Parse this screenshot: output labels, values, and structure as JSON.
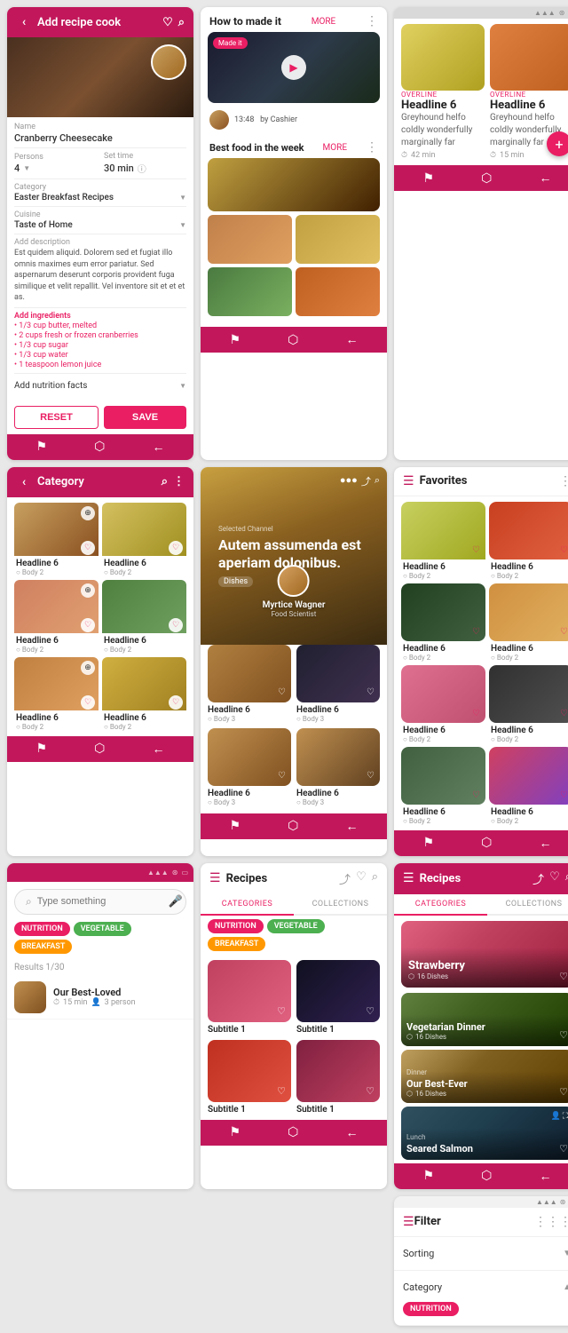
{
  "col1": {
    "card1": {
      "title": "Add recipe cook",
      "recipeName": "Cranberry Cheesecake",
      "persons_label": "Persons",
      "persons_value": "4",
      "setTime_label": "Set time",
      "setTime_value": "30 min",
      "category_label": "Category",
      "category_value": "Easter Breakfast Recipes",
      "cuisine_label": "Cuisine",
      "cuisine_value": "Taste of Home",
      "addDesc_label": "Add description",
      "description": "Est quidem aliquid. Dolorem sed et fugiat illo omnis maximes eum error pariatur. Sed aspernarum deserunt corporis provident fuga similique et velit repallit. Vel inventore sit et et et as.",
      "addIngredients_label": "Add ingredients",
      "ingredients": [
        "1/3 cup butter, melted",
        "2 cups fresh or frozen cranberries",
        "1/3 cup sugar",
        "1/3 cup water",
        "1 teaspoon lemon juice"
      ],
      "addNutrition_label": "Add nutrition facts",
      "btn_reset": "RESET",
      "btn_save": "SAVE"
    },
    "card2": {
      "title": "Category",
      "items": [
        {
          "label": "Headline 6",
          "sublabel": "Body 2"
        },
        {
          "label": "Headline 6",
          "sublabel": "Body 2"
        },
        {
          "label": "Headline 6",
          "sublabel": "Body 2"
        },
        {
          "label": "Headline 6",
          "sublabel": "Body 2"
        },
        {
          "label": "Headline 6",
          "sublabel": "Body 2"
        },
        {
          "label": "Headline 6",
          "sublabel": "Body 2"
        }
      ]
    },
    "card3": {
      "placeholder": "Type something",
      "chips": [
        "NUTRITION",
        "VEGETABLE",
        "BREAKFAST"
      ],
      "results_label": "Results 1/30",
      "result_name": "Our Best-Loved",
      "result_meta1": "15 min",
      "result_meta2": "3 person"
    }
  },
  "col2": {
    "card1": {
      "how_to": "How to made it",
      "more": "MORE",
      "made_badge": "Made it",
      "author_time": "13:48",
      "author_by": "by Cashier",
      "best_food": "Best food in the week",
      "more2": "MORE"
    },
    "card2": {
      "story_text": "Autem assumenda est aperiam dolonibus.",
      "story_sub": "Dishes",
      "author_name": "Myrtice Wagner",
      "author_role": "Food Scientist",
      "items": [
        {
          "title": "Headline 6",
          "sublabel": "Body 3"
        },
        {
          "title": "Headline 6",
          "sublabel": "Body 3"
        },
        {
          "title": "Headline 6",
          "sublabel": "Body 3"
        },
        {
          "title": "Headline 6",
          "sublabel": "Body 3"
        }
      ]
    },
    "card3": {
      "title": "Recipes",
      "tab1": "CATEGORIES",
      "tab2": "COLLECTIONS",
      "chips": [
        "NUTRITION",
        "VEGETABLE",
        "BREAKFAST"
      ],
      "sub_items": [
        {
          "title": "Subtitle 1"
        },
        {
          "title": "Subtitle 1"
        },
        {
          "title": "Subtitle 1"
        },
        {
          "title": "Subtitle 1"
        }
      ]
    }
  },
  "col3": {
    "card1": {
      "overline1": "OVERLINE",
      "headline1": "Headline 6",
      "body1": "Greyhound helfo coldly wonderfully marginally far",
      "time1": "42 min",
      "overline2": "OVERLINE",
      "headline2": "Headline 6",
      "body2": "Greyhound helfo coldly wonderfully marginally far",
      "time2": "15 min"
    },
    "card2": {
      "title": "Favorites",
      "items": [
        {
          "label": "Headline 6",
          "sublabel": "Body 2"
        },
        {
          "label": "Headline 6",
          "sublabel": "Body 2"
        },
        {
          "label": "Headline 6",
          "sublabel": "Body 2"
        },
        {
          "label": "Headline 6",
          "sublabel": "Body 2"
        },
        {
          "label": "Headline 6",
          "sublabel": "Body 2"
        },
        {
          "label": "Headline 6",
          "sublabel": "Body 2"
        },
        {
          "label": "Headline 6",
          "sublabel": "Body 2"
        },
        {
          "label": "Headline 6",
          "sublabel": "Body 2"
        }
      ]
    },
    "card3": {
      "title": "Recipes",
      "tab1": "CATEGORIES",
      "tab2": "COLLECTIONS",
      "cat1": "Strawberry",
      "cat1_count": "16 Dishes",
      "cat2": "Vegetarian Dinner",
      "cat2_count": "16 Dishes",
      "cat3": "Our Best-Ever",
      "cat3_count": "16 Dishes",
      "cat4": "Seared Salmon",
      "cat4_badge": "Lunch"
    },
    "card4": {
      "title": "Filter",
      "sort_label": "Sorting",
      "cat_label": "Category",
      "chip": "NUTRITION"
    }
  }
}
